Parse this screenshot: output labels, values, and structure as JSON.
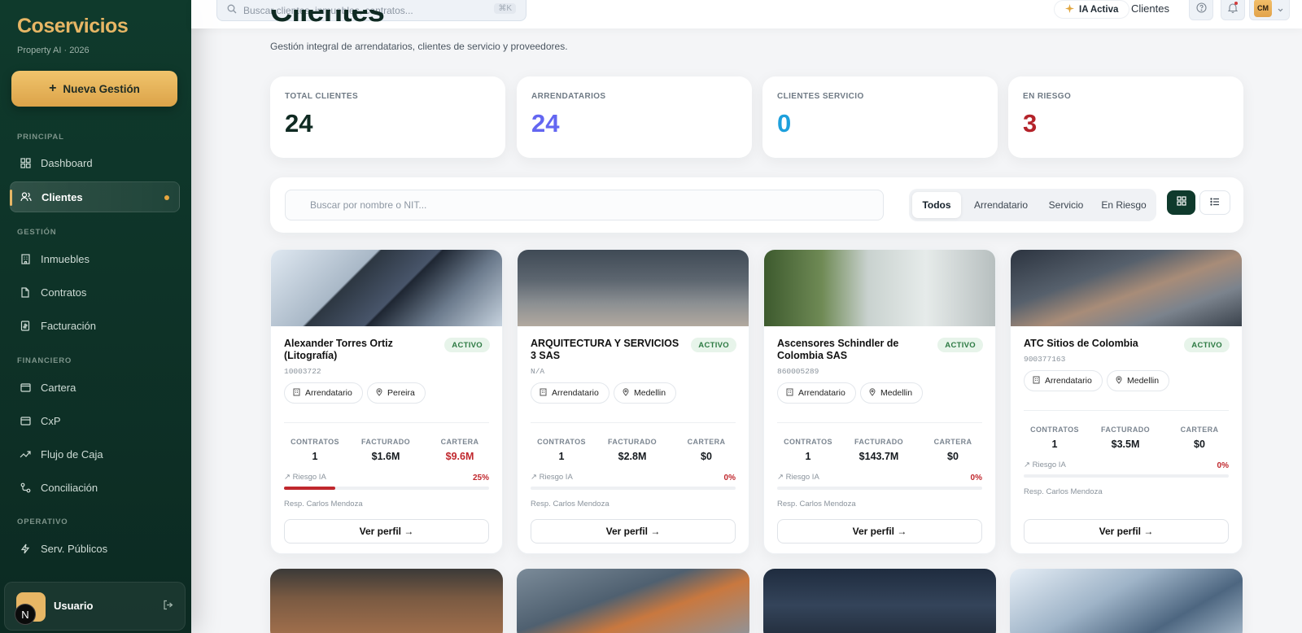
{
  "sidebar": {
    "brand": "Coservicios",
    "brand_sub": "Property AI · 2026",
    "new_button": "Nueva Gestión",
    "sections": {
      "principal": "PRINCIPAL",
      "gestion": "GESTIÓN",
      "financiero": "FINANCIERO",
      "operativo": "OPERATIVO"
    },
    "items": {
      "dashboard": "Dashboard",
      "clientes": "Clientes",
      "inmuebles": "Inmuebles",
      "contratos": "Contratos",
      "facturacion": "Facturación",
      "cartera": "Cartera",
      "cxp": "CxP",
      "flujo": "Flujo de Caja",
      "conciliacion": "Conciliación",
      "servicios": "Serv. Públicos"
    },
    "user_initial": "N",
    "user_name": "Usuario"
  },
  "topbar": {
    "search_placeholder": "Buscar clientes, inmuebles, contratos...",
    "shortcut": "⌘K",
    "ia_status": "IA Activa",
    "current_section": "Clientes",
    "avatar_initials": "CM"
  },
  "page": {
    "title": "Clientes",
    "subtitle": "Gestión integral de arrendatarios, clientes de servicio y proveedores."
  },
  "stats": [
    {
      "label": "TOTAL CLIENTES",
      "value": "24",
      "color": "#0f2a22"
    },
    {
      "label": "ARRENDATARIOS",
      "value": "24",
      "color": "#6366f1"
    },
    {
      "label": "CLIENTES SERVICIO",
      "value": "0",
      "color": "#1ea0dc"
    },
    {
      "label": "EN RIESGO",
      "value": "3",
      "color": "#b4232a"
    }
  ],
  "filters": {
    "search_placeholder": "Buscar por nombre o NIT...",
    "tabs": [
      "Todos",
      "Arrendatario",
      "Servicio",
      "En Riesgo"
    ],
    "active_tab": "Todos"
  },
  "metric_labels": {
    "contratos": "CONTRATOS",
    "facturado": "FACTURADO",
    "cartera": "CARTERA"
  },
  "risk_label": "↗ Riesgo IA",
  "profile_button": "Ver perfil →",
  "clients": [
    {
      "name": "Alexander Torres Ortiz (Litografía)",
      "status": "ACTIVO",
      "nit": "10003722",
      "type": "Arrendatario",
      "city": "Pereira",
      "contratos": "1",
      "facturado": "$1.6M",
      "cartera": "$9.6M",
      "cartera_alert": true,
      "risk": "25%",
      "risk_value": 0.25,
      "resp": "Resp. Carlos Mendoza"
    },
    {
      "name": "ARQUITECTURA Y SERVICIOS 3 SAS",
      "status": "ACTIVO",
      "nit": "N/A",
      "type": "Arrendatario",
      "city": "Medellin",
      "contratos": "1",
      "facturado": "$2.8M",
      "cartera": "$0",
      "cartera_alert": false,
      "risk": "0%",
      "risk_value": 0,
      "resp": "Resp. Carlos Mendoza"
    },
    {
      "name": "Ascensores Schindler de Colombia SAS",
      "status": "ACTIVO",
      "nit": "860005289",
      "type": "Arrendatario",
      "city": "Medellin",
      "contratos": "1",
      "facturado": "$143.7M",
      "cartera": "$0",
      "cartera_alert": false,
      "risk": "0%",
      "risk_value": 0,
      "resp": "Resp. Carlos Mendoza"
    },
    {
      "name": "ATC Sitios de Colombia",
      "status": "ACTIVO",
      "nit": "900377163",
      "type": "Arrendatario",
      "city": "Medellin",
      "contratos": "1",
      "facturado": "$3.5M",
      "cartera": "$0",
      "cartera_alert": false,
      "risk": "0%",
      "risk_value": 0,
      "resp": "Resp. Carlos Mendoza"
    }
  ]
}
